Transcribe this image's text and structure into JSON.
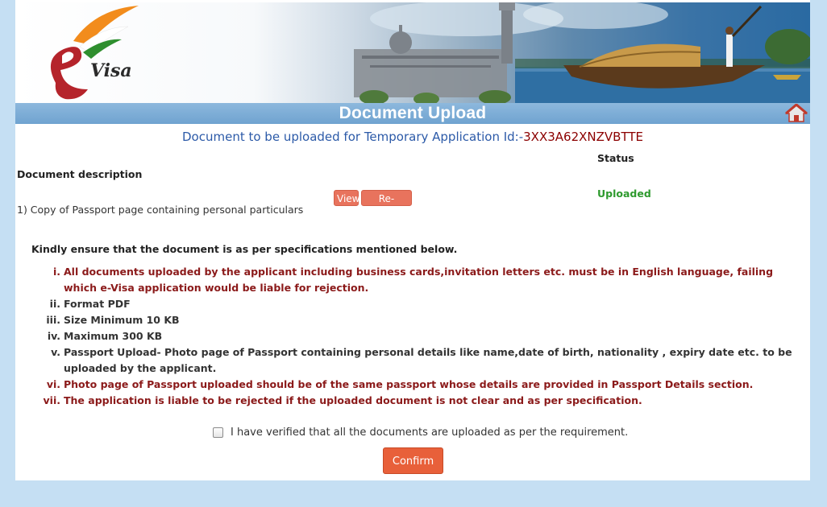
{
  "banner": {
    "logo_text": "Visa"
  },
  "page": {
    "title": "Document Upload"
  },
  "application": {
    "prefix": "Document to be uploaded for Temporary Application Id:-",
    "id": "3XX3A62XNZVBTTE"
  },
  "documents": {
    "desc_header": "Document description",
    "status_header": "Status",
    "rows": [
      {
        "label": "1) Copy of Passport page containing personal particulars",
        "view_label": "View",
        "reupload_label": "Re-upload",
        "status": "Uploaded"
      }
    ]
  },
  "specs": {
    "intro": "Kindly ensure that the document is as per specifications mentioned below.",
    "items": [
      {
        "num": "i.",
        "text": "All documents uploaded by the applicant including business cards,invitation letters etc. must be in English language, failing which e-Visa application would be liable for rejection."
      },
      {
        "num": "ii.",
        "text": "Format PDF"
      },
      {
        "num": "iii.",
        "text": "Size Minimum 10 KB"
      },
      {
        "num": "iv.",
        "text": "Maximum 300 KB"
      },
      {
        "num": "v.",
        "text": "Passport Upload- Photo page of Passport containing personal details like name,date of birth, nationality , expiry date etc. to be uploaded by the applicant."
      },
      {
        "num": "vi.",
        "text": "Photo page of Passport uploaded should be of the same passport whose details are provided in Passport Details section."
      },
      {
        "num": "vii.",
        "text": "The application is liable to be rejected if the uploaded document is not clear and as per specification."
      }
    ]
  },
  "verify": {
    "label": "I have verified that all the documents are uploaded as per the requirement."
  },
  "confirm": {
    "label": "Confirm"
  },
  "colors": {
    "page_bg": "#c5dff3",
    "title_bar": "#7aaed8",
    "button": "#e8603a",
    "status_ok": "#2e9a2e",
    "warning_text": "#8b1a1a",
    "app_id": "#8b0000"
  }
}
